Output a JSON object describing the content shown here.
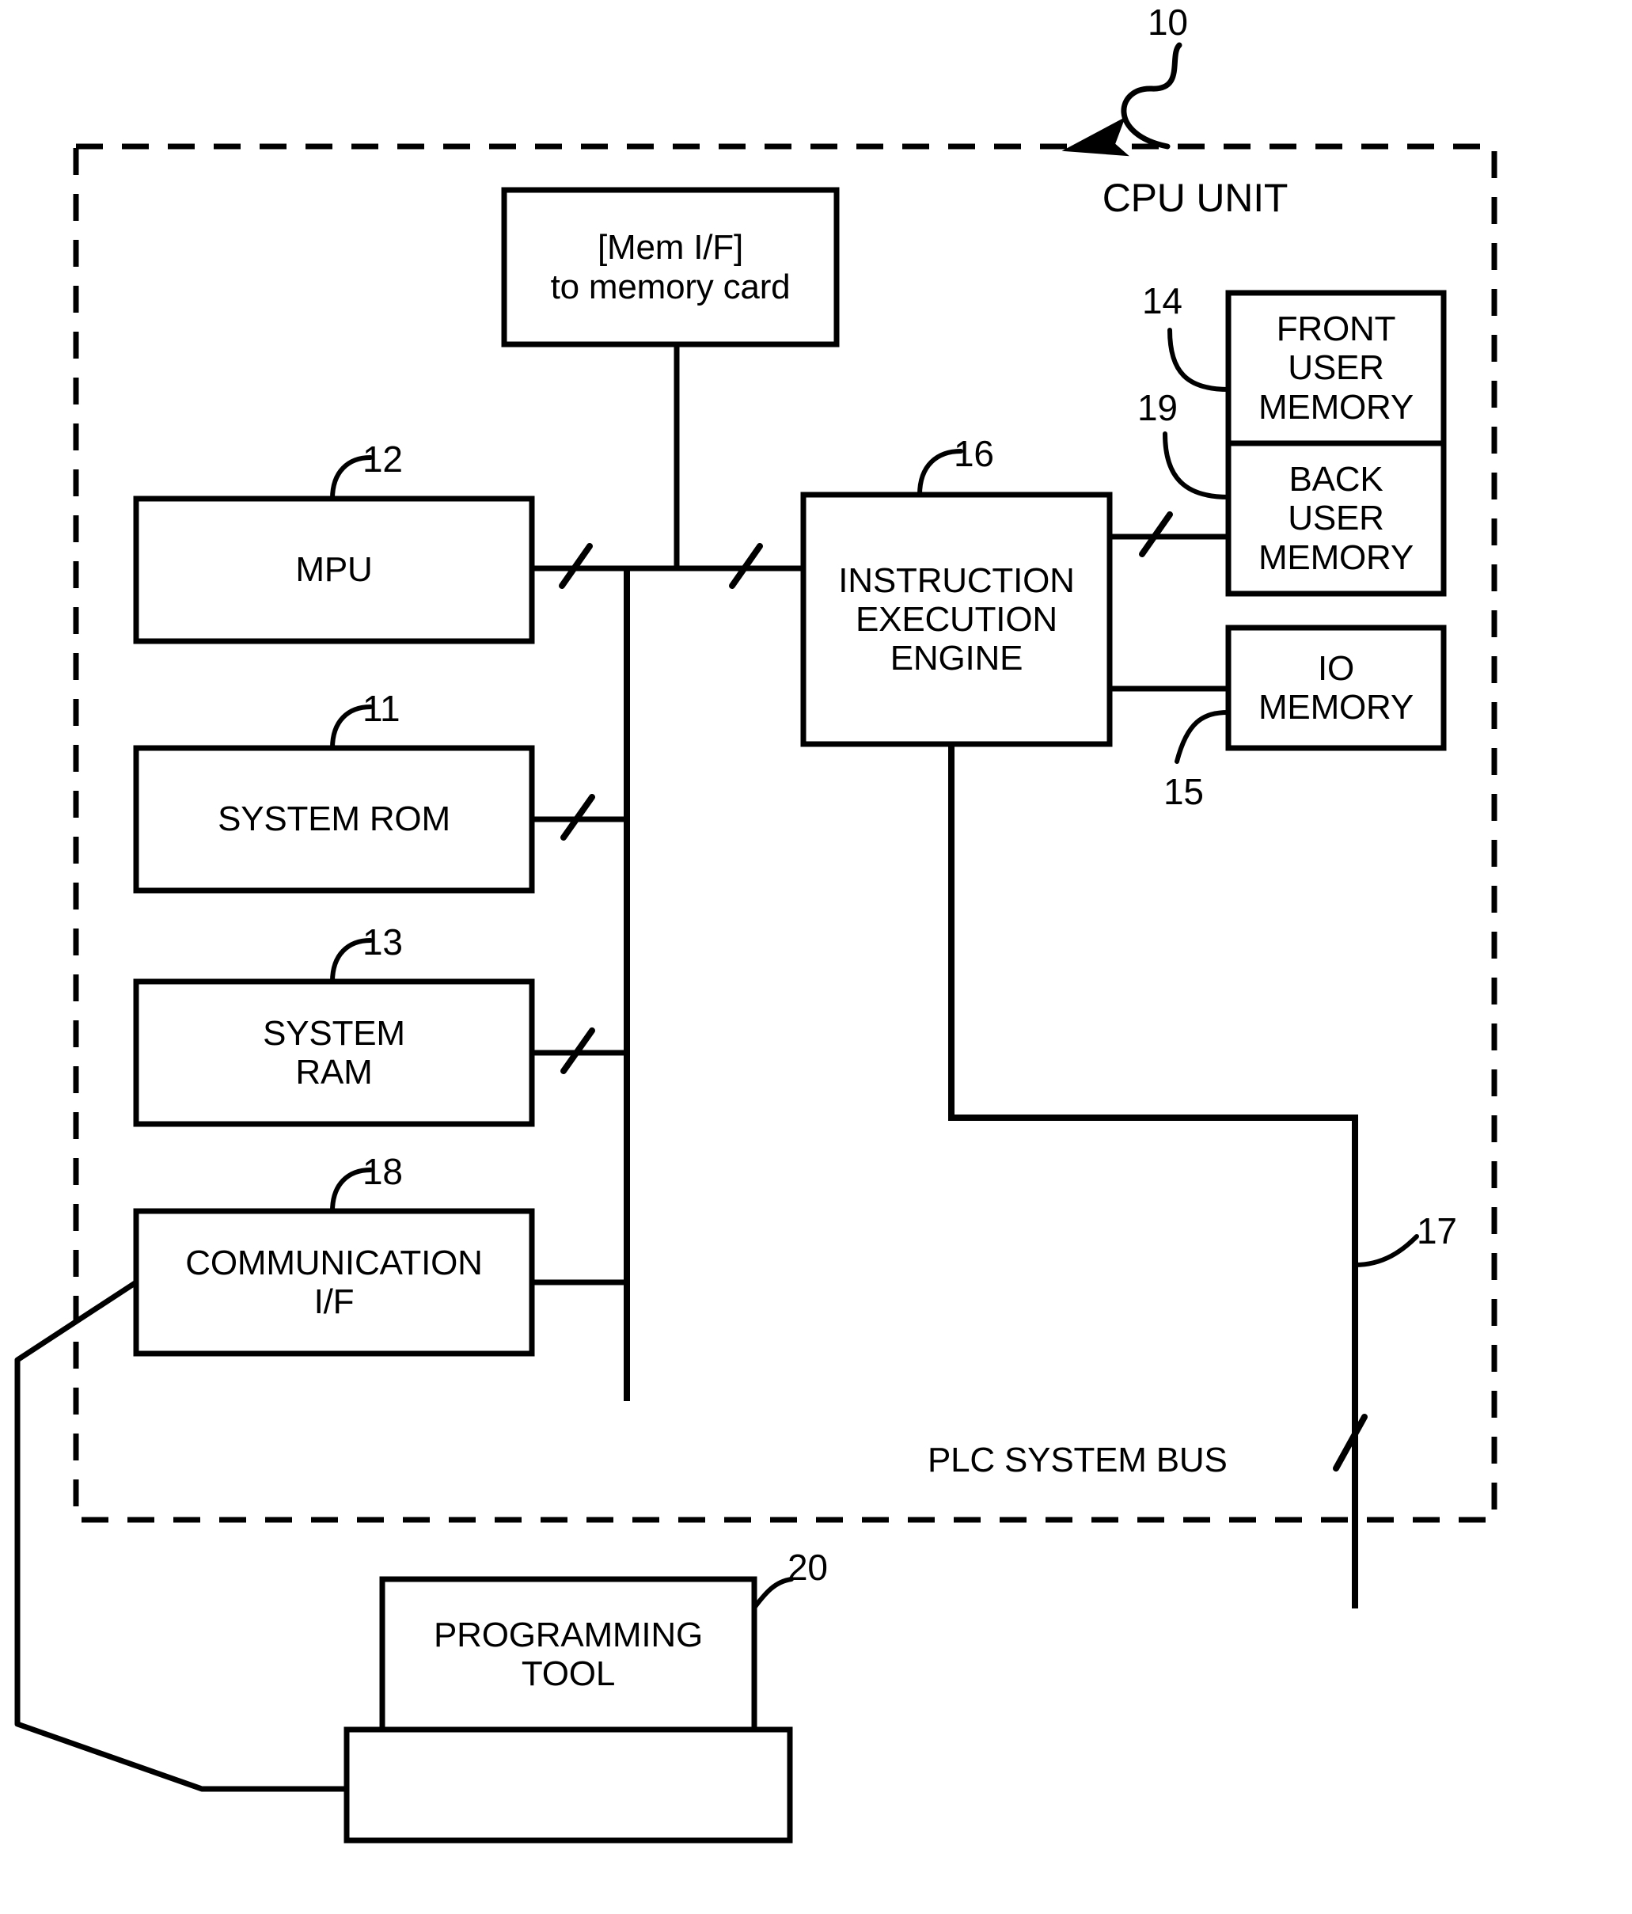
{
  "figure": {
    "title": "CPU UNIT",
    "bus_label": "PLC SYSTEM BUS"
  },
  "blocks": {
    "mem_if": {
      "label": "[Mem I/F]\nto memory card",
      "ref": ""
    },
    "mpu": {
      "label": "MPU",
      "ref": "12"
    },
    "system_rom": {
      "label": "SYSTEM ROM",
      "ref": "11"
    },
    "system_ram": {
      "label": "SYSTEM\nRAM",
      "ref": "13"
    },
    "communication_if": {
      "label": "COMMUNICATION\nI/F",
      "ref": "18"
    },
    "instruction_engine": {
      "label": "INSTRUCTION\nEXECUTION\nENGINE",
      "ref": "16"
    },
    "front_user_memory": {
      "label": "FRONT\nUSER\nMEMORY",
      "ref": "14"
    },
    "back_user_memory": {
      "label": "BACK\nUSER\nMEMORY",
      "ref": "19"
    },
    "io_memory": {
      "label": "IO\nMEMORY",
      "ref": "15"
    },
    "programming_tool": {
      "label": "PROGRAMMING\nTOOL",
      "ref": "20"
    }
  },
  "refs": {
    "cpu_unit": "10",
    "plc_system_bus": "17"
  },
  "colors": {
    "ink": "#000000",
    "paper": "#ffffff"
  }
}
